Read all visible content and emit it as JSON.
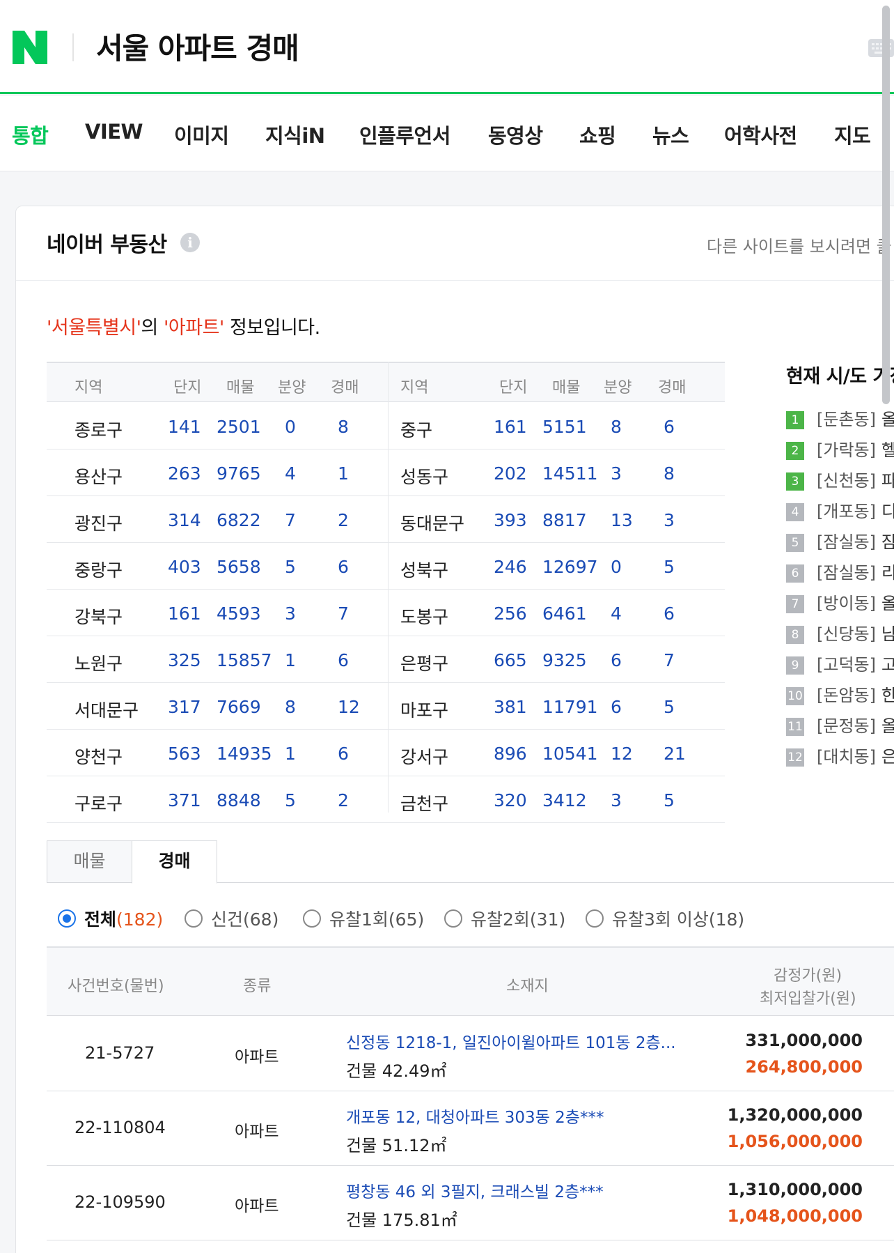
{
  "header": {
    "query": "서울 아파트 경매",
    "logo_letter": "N"
  },
  "tabs": [
    "통합",
    "VIEW",
    "이미지",
    "지식iN",
    "인플루언서",
    "동영상",
    "쇼핑",
    "뉴스",
    "어학사전",
    "지도"
  ],
  "card": {
    "title": "네이버 부동산",
    "info_icon": "info-icon",
    "other_site": "다른 사이트를 보시려면 클",
    "intro": {
      "region": "'서울특별시'",
      "mid": "의 ",
      "type": "'아파트'",
      "tail": " 정보입니다."
    }
  },
  "district_table": {
    "headers": [
      "지역",
      "단지",
      "매물",
      "분양",
      "경매"
    ],
    "rows": [
      [
        [
          "종로구",
          "141",
          "2501",
          "0",
          "8"
        ],
        [
          "중구",
          "161",
          "5151",
          "8",
          "6"
        ]
      ],
      [
        [
          "용산구",
          "263",
          "9765",
          "4",
          "1"
        ],
        [
          "성동구",
          "202",
          "14511",
          "3",
          "8"
        ]
      ],
      [
        [
          "광진구",
          "314",
          "6822",
          "7",
          "2"
        ],
        [
          "동대문구",
          "393",
          "8817",
          "13",
          "3"
        ]
      ],
      [
        [
          "중랑구",
          "403",
          "5658",
          "5",
          "6"
        ],
        [
          "성북구",
          "246",
          "12697",
          "0",
          "5"
        ]
      ],
      [
        [
          "강북구",
          "161",
          "4593",
          "3",
          "7"
        ],
        [
          "도봉구",
          "256",
          "6461",
          "4",
          "6"
        ]
      ],
      [
        [
          "노원구",
          "325",
          "15857",
          "1",
          "6"
        ],
        [
          "은평구",
          "665",
          "9325",
          "6",
          "7"
        ]
      ],
      [
        [
          "서대문구",
          "317",
          "7669",
          "8",
          "12"
        ],
        [
          "마포구",
          "381",
          "11791",
          "6",
          "5"
        ]
      ],
      [
        [
          "양천구",
          "563",
          "14935",
          "1",
          "6"
        ],
        [
          "강서구",
          "896",
          "10541",
          "12",
          "21"
        ]
      ],
      [
        [
          "구로구",
          "371",
          "8848",
          "5",
          "2"
        ],
        [
          "금천구",
          "320",
          "3412",
          "3",
          "5"
        ]
      ]
    ]
  },
  "ranking": {
    "title": "현재 시/도 가장",
    "items": [
      {
        "rank": "1",
        "name": "[둔촌동]",
        "tail": "올",
        "color": "#4cb548"
      },
      {
        "rank": "2",
        "name": "[가락동]",
        "tail": "헬",
        "color": "#4cb548"
      },
      {
        "rank": "3",
        "name": "[신천동]",
        "tail": "파",
        "color": "#4cb548"
      },
      {
        "rank": "4",
        "name": "[개포동]",
        "tail": "디",
        "color": "#b5b8bd"
      },
      {
        "rank": "5",
        "name": "[잠실동]",
        "tail": "잠",
        "color": "#b5b8bd"
      },
      {
        "rank": "6",
        "name": "[잠실동]",
        "tail": "리",
        "color": "#b5b8bd"
      },
      {
        "rank": "7",
        "name": "[방이동]",
        "tail": "올",
        "color": "#b5b8bd"
      },
      {
        "rank": "8",
        "name": "[신당동]",
        "tail": "남",
        "color": "#b5b8bd"
      },
      {
        "rank": "9",
        "name": "[고덕동]",
        "tail": "고",
        "color": "#b5b8bd"
      },
      {
        "rank": "10",
        "name": "[돈암동]",
        "tail": "한",
        "color": "#b5b8bd"
      },
      {
        "rank": "11",
        "name": "[문정동]",
        "tail": "올",
        "color": "#b5b8bd"
      },
      {
        "rank": "12",
        "name": "[대치동]",
        "tail": "은",
        "color": "#b5b8bd"
      }
    ]
  },
  "subtabs": {
    "listing": "매물",
    "auction": "경매"
  },
  "filters": [
    {
      "label": "전체",
      "count": "(182)",
      "selected": true
    },
    {
      "label": "신건",
      "count": "(68)",
      "selected": false
    },
    {
      "label": "유찰1회",
      "count": "(65)",
      "selected": false
    },
    {
      "label": "유찰2회",
      "count": "(31)",
      "selected": false
    },
    {
      "label": "유찰3회 이상",
      "count": "(18)",
      "selected": false
    }
  ],
  "auction_table": {
    "headers": {
      "case": "사건번호(물번)",
      "kind": "종류",
      "location": "소재지",
      "appraisal": "감정가(원)",
      "min_bid": "최저입찰가(원)"
    },
    "rows": [
      {
        "case": "21-5727",
        "kind": "아파트",
        "address": "신정동 1218-1, 일진아이윌아파트 101동 2층...",
        "area": "건물 42.49㎡",
        "appraisal": "331,000,000",
        "min_bid": "264,800,000"
      },
      {
        "case": "22-110804",
        "kind": "아파트",
        "address": "개포동 12, 대청아파트 303동 2층***",
        "area": "건물 51.12㎡",
        "appraisal": "1,320,000,000",
        "min_bid": "1,056,000,000"
      },
      {
        "case": "22-109590",
        "kind": "아파트",
        "address": "평창동 46 외 3필지, 크래스빌 2층***",
        "area": "건물 175.81㎡",
        "appraisal": "1,310,000,000",
        "min_bid": "1,048,000,000"
      }
    ]
  },
  "colors": {
    "brand": "#03c75a",
    "link": "#1a4bb5",
    "highlight": "#e5341b",
    "price": "#e5541b",
    "radio": "#1a73e8"
  }
}
